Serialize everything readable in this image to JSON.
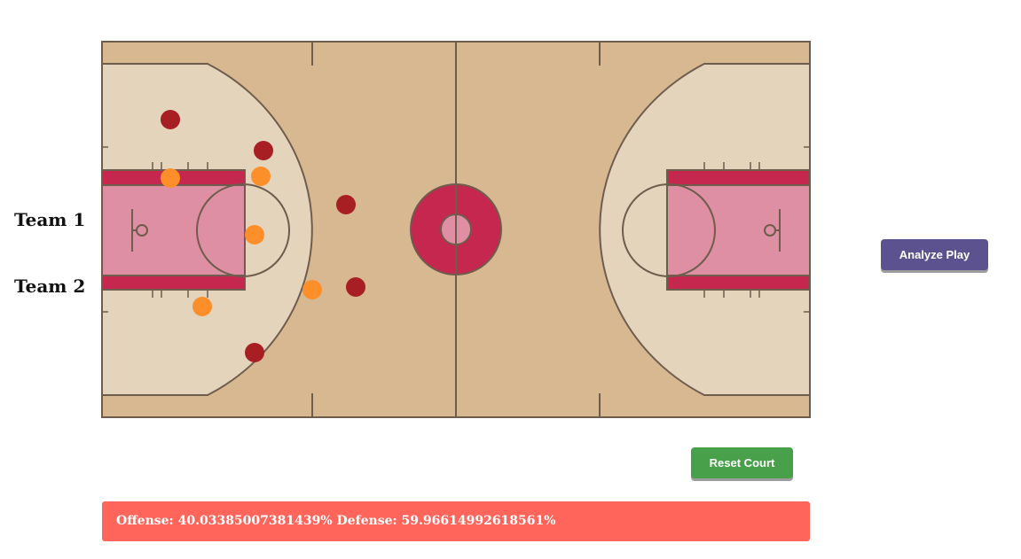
{
  "legend": {
    "team1": {
      "label": "Team 1",
      "color": "#a71e23"
    },
    "team2": {
      "label": "Team 2",
      "color": "#fd8f2a"
    }
  },
  "colors": {
    "wood": "#d8b891",
    "light_wood": "#e4d4bc",
    "paint": "#df8fa3",
    "accent": "#c5274e",
    "lines": "#6e5c4d"
  },
  "buttons": {
    "analyze": "Analyze Play",
    "reset": "Reset Court"
  },
  "result": {
    "offense_label": "Offense:",
    "offense_value": "40.03385007381439%",
    "defense_label": "Defense:",
    "defense_value": "59.96614992618561%"
  }
}
